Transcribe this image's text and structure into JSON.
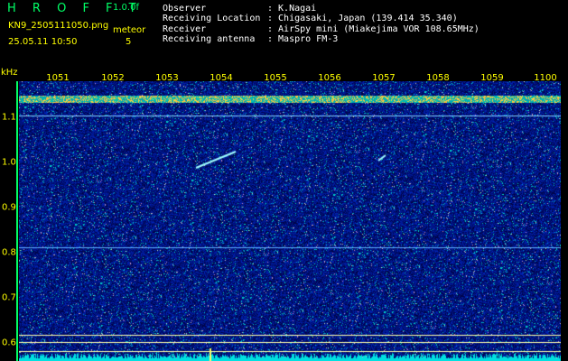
{
  "header": {
    "app_title": "H R O F F T",
    "version": "1.0.0f",
    "filename": "KN9_2505111050.png",
    "mode": "meteor",
    "datetime": "25.05.11 10:50",
    "count": "5",
    "info": [
      {
        "label": "Observer",
        "value": ": K.Nagai"
      },
      {
        "label": "Receiving Location",
        "value": ": Chigasaki, Japan (139.414 35.340)"
      },
      {
        "label": "Receiver",
        "value": ": AirSpy mini (Miakejima VOR 108.65MHz)"
      },
      {
        "label": "Receiving antenna",
        "value": ": Maspro FM-3"
      }
    ]
  },
  "axis": {
    "x_unit": "",
    "y_unit": "kHz",
    "x_labels": [
      "1051",
      "1052",
      "1053",
      "1054",
      "1055",
      "1056",
      "1057",
      "1058",
      "1059",
      "1100"
    ],
    "y_labels": [
      "1.1",
      "1.0",
      "0.9",
      "0.8",
      "0.7",
      "0.6"
    ]
  },
  "colors": {
    "background": "#00003c",
    "text": "#ffff00",
    "title": "#00ff66"
  }
}
